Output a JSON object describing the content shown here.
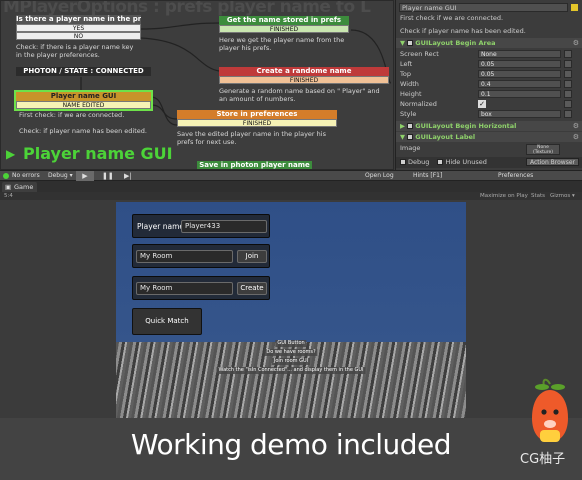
{
  "fsm": {
    "title": "MPlayerOptions : prefs player name to L",
    "big_label": "Player name GUI",
    "nodes": [
      {
        "id": "is_there",
        "header": "Is there a player name in the prefs?",
        "transitions": [
          "YES",
          "NO"
        ],
        "description": "Check: if there is a player name key in the player preferences."
      },
      {
        "id": "get_name",
        "header": "Get the name stored in prefs",
        "transitions": [
          "FINISHED"
        ],
        "description": "Here we get the player name from the player his prefs."
      },
      {
        "id": "photon_state",
        "header": "PHOTON / STATE : CONNECTED",
        "transitions": [],
        "description": ""
      },
      {
        "id": "create_random",
        "header": "Create a randome name",
        "transitions": [
          "FINISHED"
        ],
        "description": "Generate a random name based on \" Player\" and an amount of numbers."
      },
      {
        "id": "player_name_gui",
        "header": "Player name GUI",
        "transitions": [
          "NAME EDITED"
        ],
        "description": "First check: if we are connected.\n\nCheck: if player name has been edited."
      },
      {
        "id": "store_prefs",
        "header": "Store in preferences",
        "transitions": [
          "FINISHED"
        ],
        "description": "Save the edited player name in the player his prefs for next use."
      },
      {
        "id": "save_photon",
        "header": "Save in photon player name",
        "transitions": [],
        "description": ""
      }
    ]
  },
  "inspector": {
    "state_name": "Player name GUI",
    "desc1": "First check if we are connected.",
    "desc2": "Check if player name has been edited.",
    "begin_area": "GUILayout Begin Area",
    "fields": [
      {
        "label": "Screen Rect",
        "value": "None"
      },
      {
        "label": "Left",
        "value": "0.05"
      },
      {
        "label": "Top",
        "value": "0.05"
      },
      {
        "label": "Width",
        "value": "0.4"
      },
      {
        "label": "Height",
        "value": "0.1"
      },
      {
        "label": "Normalized",
        "value": "✓"
      },
      {
        "label": "Style",
        "value": "box"
      }
    ],
    "begin_horizontal": "GUILayout Begin Horizontal",
    "label_action": "GUILayout Label",
    "image_label": "Image",
    "image_value": "None\n(Texture)",
    "debug": "Debug",
    "hide_unused": "Hide Unused",
    "action_browser": "Action Browser"
  },
  "toolbar": {
    "no_errors": "No errors",
    "debug": "Debug ▾",
    "open_log": "Open Log",
    "hints": "Hints [F1]",
    "preferences": "Preferences"
  },
  "game_tab": {
    "label": "Game",
    "aspect": "5:4",
    "maximize": "Maximize on Play",
    "stats": "Stats",
    "gizmos": "Gizmos ▾"
  },
  "game": {
    "player_name_label": "Player name:",
    "player_name_value": "Player433",
    "join_room_value": "My Room",
    "join_button": "Join",
    "create_room_value": "My Room",
    "create_button": "Create",
    "quick_match_button": "Quick Match",
    "debug_lines": [
      "GUI Button",
      "Do we have rooms?",
      "Join room GUI",
      "Watch the \"isIn Connected\"... and display them in the GUI"
    ]
  },
  "footer": {
    "caption": "Working demo included",
    "watermark": "CG柚子"
  },
  "colors": {
    "accent_green": "#4cd338",
    "state_red": "#bf3a3a",
    "state_orange": "#d47d2a"
  }
}
